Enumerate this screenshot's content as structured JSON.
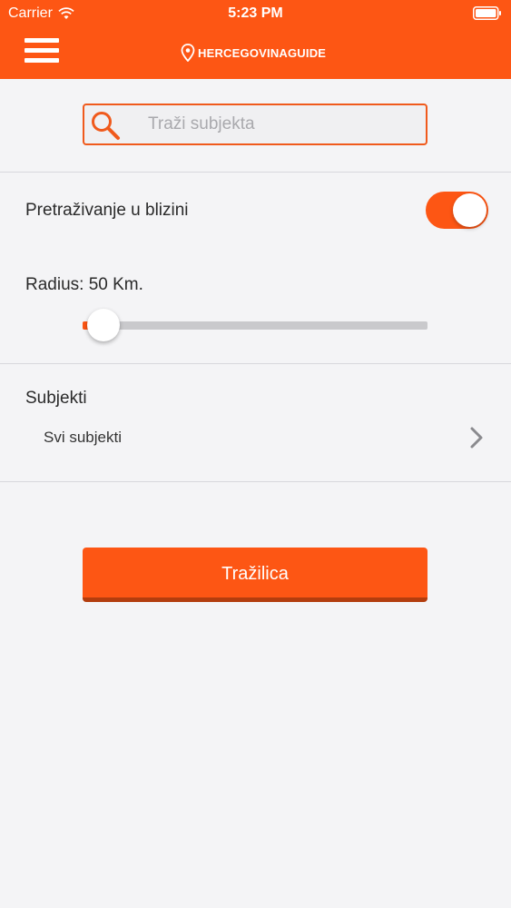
{
  "status_bar": {
    "carrier": "Carrier",
    "time": "5:23 PM"
  },
  "nav": {
    "brand": "HERCEGOVINAGUIDE"
  },
  "search": {
    "placeholder": "Traži subjekta",
    "value": ""
  },
  "nearby": {
    "label": "Pretraživanje u blizini",
    "enabled": true
  },
  "radius": {
    "label": "Radius: 50 Km.",
    "value_km": 50,
    "slider_fraction": 0.06
  },
  "subjects": {
    "title": "Subjekti",
    "selected": "Svi subjekti"
  },
  "actions": {
    "search_button": "Tražilica"
  },
  "colors": {
    "accent": "#fd5614",
    "background": "#f4f4f6",
    "slider_track": "#c9c9cc"
  },
  "icons": {
    "menu": "hamburger-menu-icon",
    "brand": "location-pin-icon",
    "search": "magnifier-icon",
    "chevron": "chevron-right-icon",
    "wifi": "wifi-icon",
    "battery": "battery-icon"
  }
}
